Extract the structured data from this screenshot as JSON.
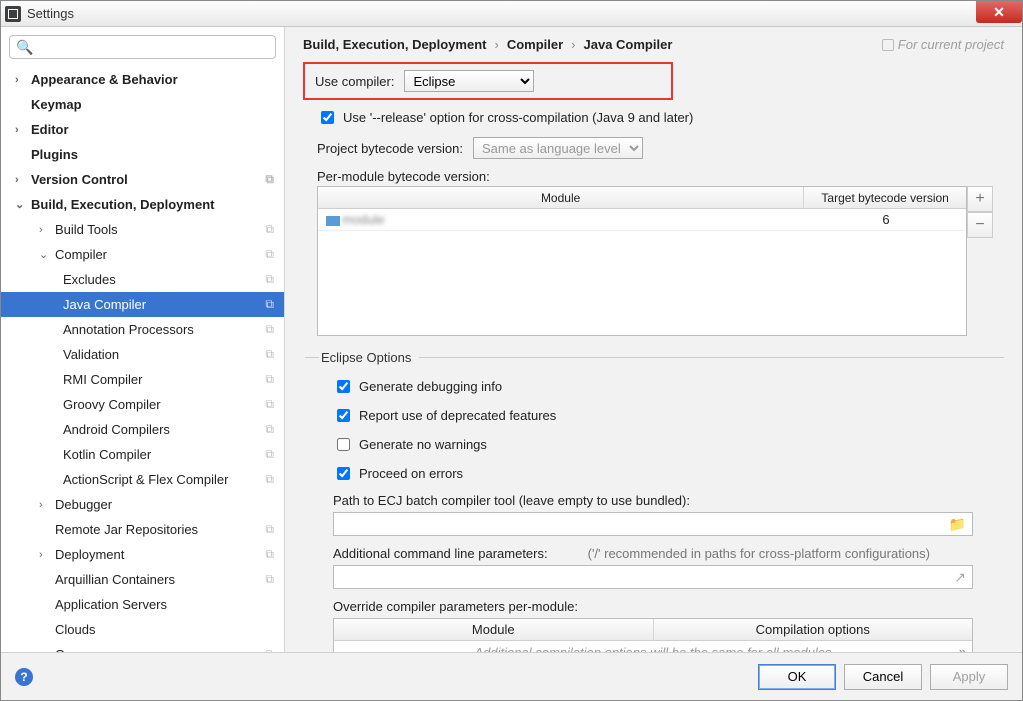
{
  "window": {
    "title": "Settings"
  },
  "search": {
    "placeholder": ""
  },
  "sidebar": [
    {
      "label": "Appearance & Behavior",
      "depth": 0,
      "arrow": "›",
      "bold": true
    },
    {
      "label": "Keymap",
      "depth": 0,
      "arrow": "",
      "bold": true,
      "noarrow": true
    },
    {
      "label": "Editor",
      "depth": 0,
      "arrow": "›",
      "bold": true
    },
    {
      "label": "Plugins",
      "depth": 0,
      "arrow": "",
      "bold": true,
      "noarrow": true
    },
    {
      "label": "Version Control",
      "depth": 0,
      "arrow": "›",
      "bold": true,
      "copy": true
    },
    {
      "label": "Build, Execution, Deployment",
      "depth": 0,
      "arrow": "⌄",
      "bold": true
    },
    {
      "label": "Build Tools",
      "depth": 1,
      "arrow": "›",
      "copy": true
    },
    {
      "label": "Compiler",
      "depth": 1,
      "arrow": "⌄",
      "copy": true
    },
    {
      "label": "Excludes",
      "depth": 2,
      "copy": true
    },
    {
      "label": "Java Compiler",
      "depth": 2,
      "copy": true,
      "selected": true
    },
    {
      "label": "Annotation Processors",
      "depth": 2,
      "copy": true
    },
    {
      "label": "Validation",
      "depth": 2,
      "copy": true
    },
    {
      "label": "RMI Compiler",
      "depth": 2,
      "copy": true
    },
    {
      "label": "Groovy Compiler",
      "depth": 2,
      "copy": true
    },
    {
      "label": "Android Compilers",
      "depth": 2,
      "copy": true
    },
    {
      "label": "Kotlin Compiler",
      "depth": 2,
      "copy": true
    },
    {
      "label": "ActionScript & Flex Compiler",
      "depth": 2,
      "copy": true
    },
    {
      "label": "Debugger",
      "depth": 1,
      "arrow": "›"
    },
    {
      "label": "Remote Jar Repositories",
      "depth": 1,
      "copy": true
    },
    {
      "label": "Deployment",
      "depth": 1,
      "arrow": "›",
      "copy": true
    },
    {
      "label": "Arquillian Containers",
      "depth": 1,
      "copy": true
    },
    {
      "label": "Application Servers",
      "depth": 1
    },
    {
      "label": "Clouds",
      "depth": 1
    },
    {
      "label": "Coverage",
      "depth": 1,
      "copy": true
    }
  ],
  "breadcrumb": {
    "a": "Build, Execution, Deployment",
    "b": "Compiler",
    "c": "Java Compiler",
    "hint": "For current project"
  },
  "form": {
    "useCompilerLabel": "Use compiler:",
    "useCompilerValue": "Eclipse",
    "releaseOption": "Use '--release' option for cross-compilation (Java 9 and later)",
    "projectBytecodeLabel": "Project bytecode version:",
    "projectBytecodeValue": "Same as language level",
    "perModuleLabel": "Per-module bytecode version:",
    "moduleHead1": "Module",
    "moduleHead2": "Target bytecode version",
    "moduleTarget": "6",
    "eclipseLegend": "Eclipse Options",
    "opt1": "Generate debugging info",
    "opt2": "Report use of deprecated features",
    "opt3": "Generate no warnings",
    "opt4": "Proceed on errors",
    "ecjLabel": "Path to ECJ batch compiler tool (leave empty to use bundled):",
    "addParamsLabel": "Additional command line parameters:",
    "addParamsHint": "('/' recommended in paths for cross-platform configurations)",
    "overrideLabel": "Override compiler parameters per-module:",
    "overrideHead1": "Module",
    "overrideHead2": "Compilation options",
    "overrideEmpty": "Additional compilation options will be the same for all modules"
  },
  "footer": {
    "ok": "OK",
    "cancel": "Cancel",
    "apply": "Apply"
  }
}
